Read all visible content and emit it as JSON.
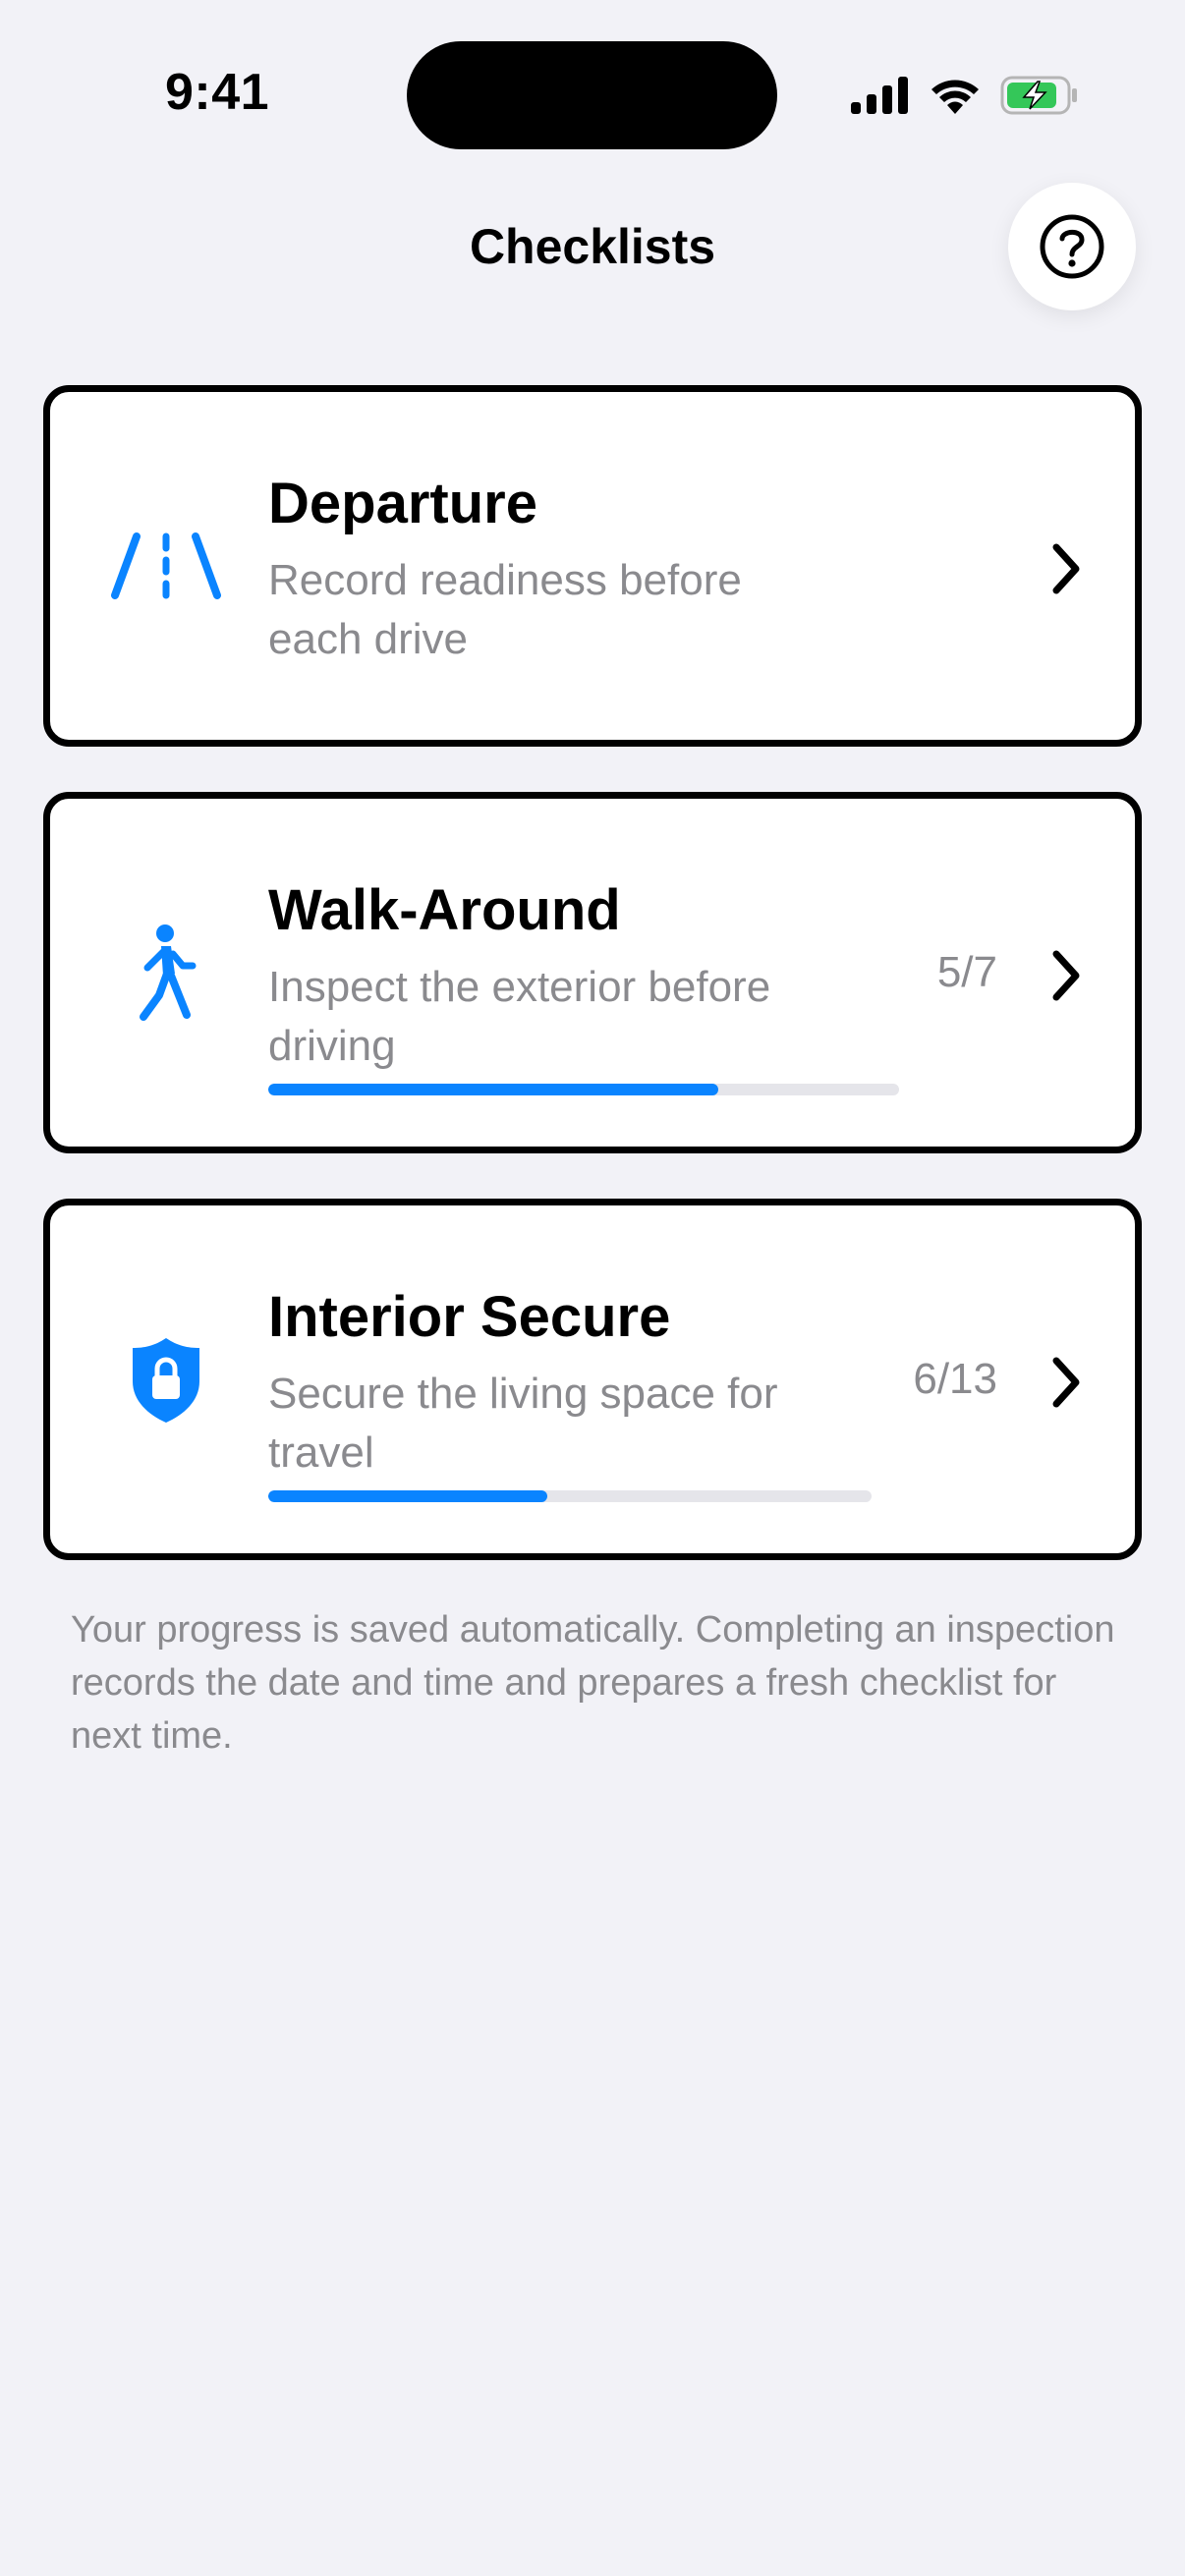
{
  "status_bar": {
    "time": "9:41",
    "battery_color": "#34C759"
  },
  "header": {
    "title": "Checklists",
    "help_icon": "question-circle-icon"
  },
  "accent_color": "#0A84FF",
  "checklists": [
    {
      "title": "Departure",
      "description": "Record readiness before each drive",
      "icon": "road-icon",
      "count": null,
      "progress": null
    },
    {
      "title": "Walk-Around",
      "description": "Inspect the exterior before driving",
      "icon": "walking-person-icon",
      "count": "5/7",
      "progress": 0.714
    },
    {
      "title": "Interior Secure",
      "description": "Secure the living space for travel",
      "icon": "lock-shield-icon",
      "count": "6/13",
      "progress": 0.462
    }
  ],
  "footer_note": "Your progress is saved automatically. Completing an inspection records the date and time and prepares a fresh checklist for next time."
}
